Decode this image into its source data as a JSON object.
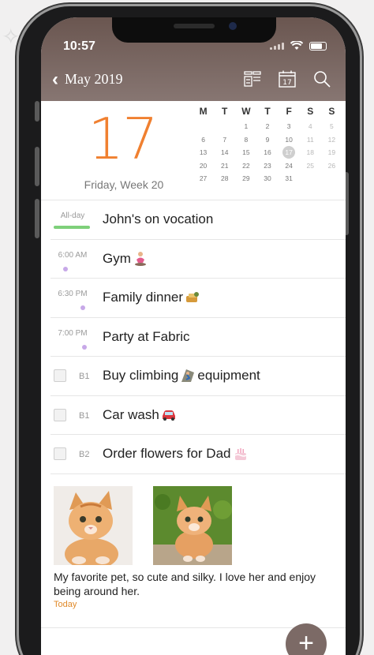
{
  "status_bar": {
    "time": "10:57"
  },
  "nav": {
    "back_label": "May 2019"
  },
  "date_header": {
    "day_number": "17",
    "subtitle": "Friday, Week 20"
  },
  "mini_calendar": {
    "weekdays": [
      "M",
      "T",
      "W",
      "T",
      "F",
      "S",
      "S"
    ],
    "weeks": [
      [
        "",
        "",
        "1",
        "2",
        "3",
        "4",
        "5"
      ],
      [
        "6",
        "7",
        "8",
        "9",
        "10",
        "11",
        "12"
      ],
      [
        "13",
        "14",
        "15",
        "16",
        "17",
        "18",
        "19"
      ],
      [
        "20",
        "21",
        "22",
        "23",
        "24",
        "25",
        "26"
      ],
      [
        "27",
        "28",
        "29",
        "30",
        "31",
        "",
        ""
      ]
    ],
    "selected": "17"
  },
  "events": [
    {
      "time": "All-day",
      "title": "John's on vocation"
    },
    {
      "time": "6:00 AM",
      "title": "Gym"
    },
    {
      "time": "6:30 PM",
      "title": "Family dinner"
    },
    {
      "time": "7:00 PM",
      "title": "Party at Fabric"
    }
  ],
  "tasks": [
    {
      "priority": "B1",
      "title_before": "Buy climbing",
      "title_after": "equipment"
    },
    {
      "priority": "B1",
      "title": "Car wash"
    },
    {
      "priority": "B2",
      "title": "Order flowers for Dad"
    }
  ],
  "note": {
    "text": "My favorite pet, so cute and silky. I love her and enjoy being around her.",
    "date": "Today"
  },
  "fab": {
    "label": "+"
  },
  "colors": {
    "accent_orange": "#f08030",
    "allday_green": "#7ed07a",
    "event_dot_purple": "#c7a8e8",
    "topbar": "#7a6863"
  }
}
